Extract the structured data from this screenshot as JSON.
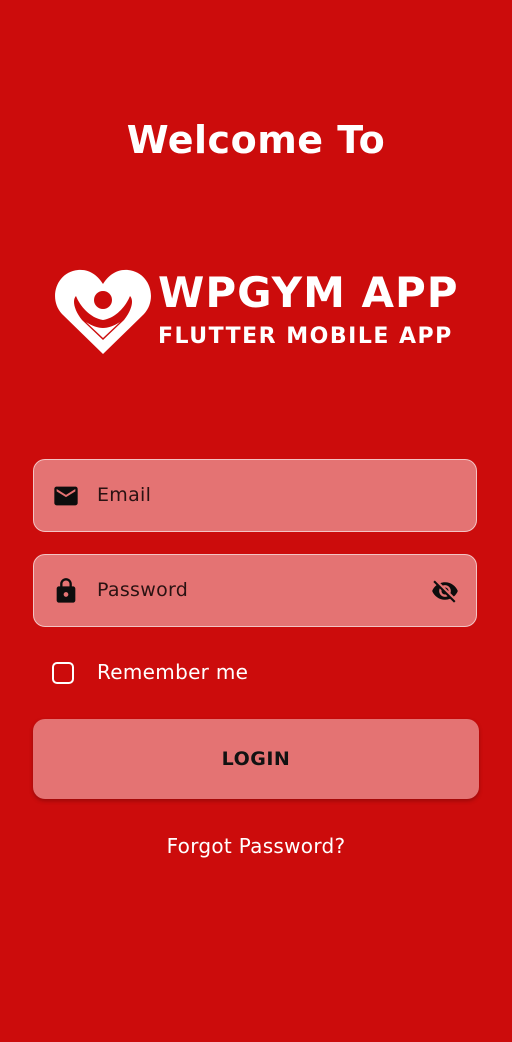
{
  "welcome": {
    "title": "Welcome To"
  },
  "logo": {
    "title": "WPGYM APP",
    "subtitle": "FLUTTER MOBILE APP",
    "icon": "heart-figure-icon"
  },
  "form": {
    "email": {
      "placeholder": "Email",
      "icon": "mail-icon"
    },
    "password": {
      "placeholder": "Password",
      "icon": "lock-icon",
      "toggle_icon": "eye-off-icon"
    },
    "remember": {
      "label": "Remember me",
      "checked": false
    },
    "login_label": "LOGIN",
    "forgot_label": "Forgot Password?"
  },
  "colors": {
    "background": "#cc0c0c",
    "field_fill": "#e47373",
    "text_light": "#ffffff"
  }
}
